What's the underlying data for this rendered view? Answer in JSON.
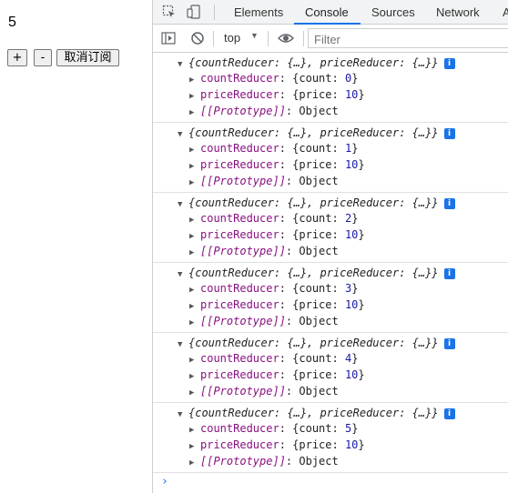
{
  "page": {
    "counter_value": "5",
    "buttons": {
      "plus": "+",
      "minus": "-",
      "unsubscribe": "取消订阅"
    }
  },
  "devtools": {
    "tabs": [
      {
        "label": "Elements",
        "active": false
      },
      {
        "label": "Console",
        "active": true
      },
      {
        "label": "Sources",
        "active": false
      },
      {
        "label": "Network",
        "active": false
      },
      {
        "label": "A",
        "active": false
      }
    ],
    "toolbar": {
      "context": "top",
      "filter_placeholder": "Filter"
    },
    "console": {
      "entries": [
        {
          "summary": "{countReducer: {…}, priceReducer: {…}}",
          "count_key": "countReducer",
          "count_val": "{count: 0}",
          "price_key": "priceReducer",
          "price_val": "{price: 10}",
          "proto_key": "[[Prototype]]",
          "proto_val": "Object"
        },
        {
          "summary": "{countReducer: {…}, priceReducer: {…}}",
          "count_key": "countReducer",
          "count_val": "{count: 1}",
          "price_key": "priceReducer",
          "price_val": "{price: 10}",
          "proto_key": "[[Prototype]]",
          "proto_val": "Object"
        },
        {
          "summary": "{countReducer: {…}, priceReducer: {…}}",
          "count_key": "countReducer",
          "count_val": "{count: 2}",
          "price_key": "priceReducer",
          "price_val": "{price: 10}",
          "proto_key": "[[Prototype]]",
          "proto_val": "Object"
        },
        {
          "summary": "{countReducer: {…}, priceReducer: {…}}",
          "count_key": "countReducer",
          "count_val": "{count: 3}",
          "price_key": "priceReducer",
          "price_val": "{price: 10}",
          "proto_key": "[[Prototype]]",
          "proto_val": "Object"
        },
        {
          "summary": "{countReducer: {…}, priceReducer: {…}}",
          "count_key": "countReducer",
          "count_val": "{count: 4}",
          "price_key": "priceReducer",
          "price_val": "{price: 10}",
          "proto_key": "[[Prototype]]",
          "proto_val": "Object"
        },
        {
          "summary": "{countReducer: {…}, priceReducer: {…}}",
          "count_key": "countReducer",
          "count_val": "{count: 5}",
          "price_key": "priceReducer",
          "price_val": "{price: 10}",
          "proto_key": "[[Prototype]]",
          "proto_val": "Object"
        }
      ],
      "prompt": "›"
    }
  },
  "icons": {
    "inspect": "inspect-element-icon",
    "device": "device-toolbar-icon",
    "sidebar": "console-sidebar-icon",
    "clear": "clear-console-icon",
    "eye": "live-expression-icon",
    "info": "info-icon"
  },
  "colors": {
    "accent": "#1a73e8",
    "key": "#881280",
    "value": "#1a1aa6"
  }
}
